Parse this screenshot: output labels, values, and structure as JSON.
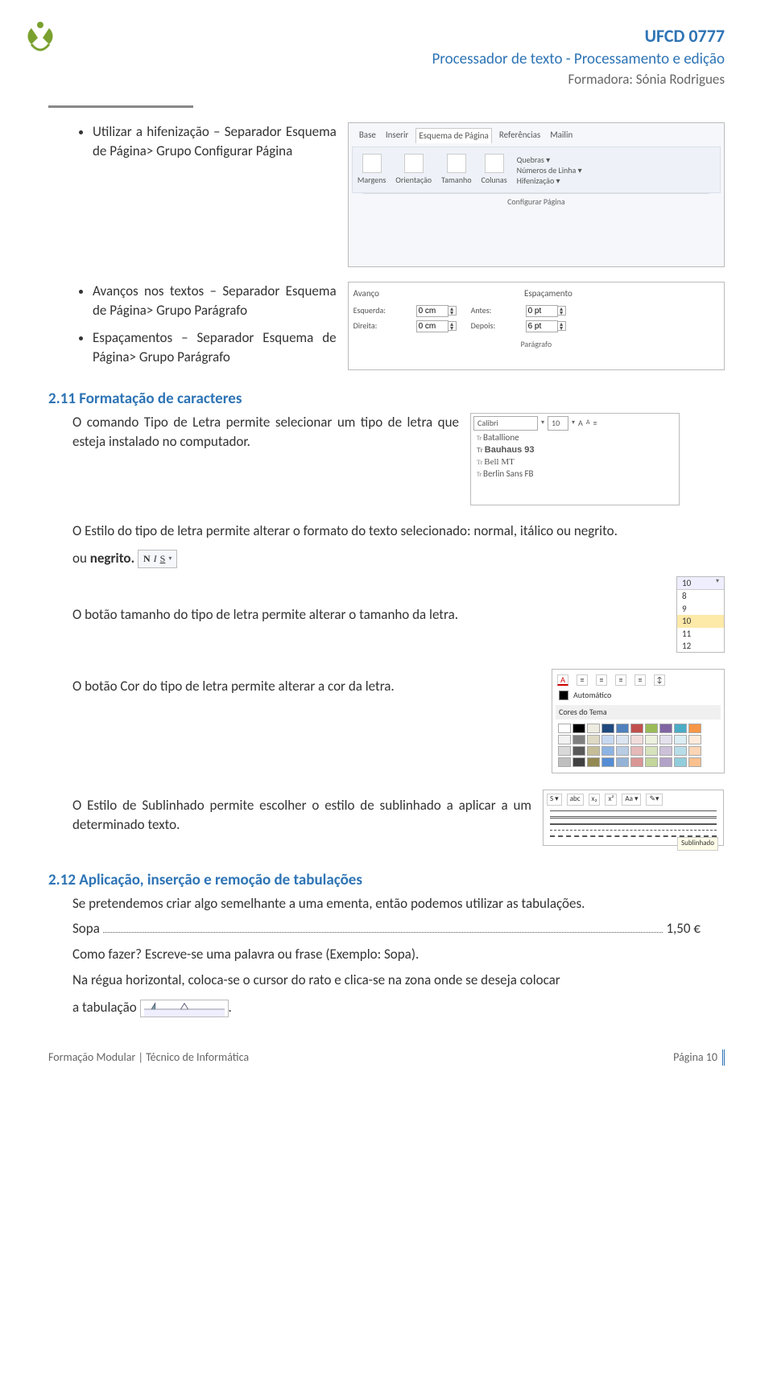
{
  "header": {
    "title": "UFCD 0777",
    "subtitle": "Processador de texto - Processamento e edição",
    "trainer": "Formadora: Sónia Rodrigues"
  },
  "bullets_top": [
    "Utilizar a hifenização – Separador Esquema de Página> Grupo Configurar Página",
    "Avanços nos textos – Separador Esquema de Página> Grupo Parágrafo",
    "Espaçamentos – Separador Esquema de Página> Grupo Parágrafo"
  ],
  "ribbon": {
    "tabs": [
      "Base",
      "Inserir",
      "Esquema de Página",
      "Referências",
      "Mailin"
    ],
    "active_tab": "Esquema de Página",
    "buttons": [
      "Margens",
      "Orientação",
      "Tamanho",
      "Colunas"
    ],
    "side_items": [
      "Quebras ▾",
      "Números de Linha ▾",
      "Hifenização ▾"
    ],
    "group_label": "Configurar Página"
  },
  "para_dialog": {
    "hdr_left": "Avanço",
    "hdr_right": "Espaçamento",
    "rows": [
      {
        "left_label": "Esquerda:",
        "left_val": "0 cm",
        "right_label": "Antes:",
        "right_val": "0 pt"
      },
      {
        "left_label": "Direita:",
        "left_val": "0 cm",
        "right_label": "Depois:",
        "right_val": "6 pt"
      }
    ],
    "group_label": "Parágrafo"
  },
  "sec211": {
    "heading": "2.11 Formatação de caracteres",
    "p1": "O comando Tipo de Letra permite selecionar um tipo de letra que esteja instalado no computador.",
    "font_combo": {
      "font": "Calibri",
      "size": "10",
      "extra": "A  A"
    },
    "font_list": [
      "Batallione",
      "Bauhaus 93",
      "Bell MT",
      "Berlin Sans FB"
    ],
    "p2a": "O Estilo do tipo de letra permite alterar o formato do texto selecionado: normal, itálico ou negrito.",
    "p2_prefix": "ou ",
    "p2_bold": "negrito.",
    "bolditalic": {
      "b": "N",
      "i": "I",
      "u": "S",
      "arrow": "▾"
    },
    "p3": "O botão tamanho do tipo de letra permite alterar o tamanho da letra.",
    "sizelist": {
      "top": "10",
      "items": [
        "8",
        "9",
        "10",
        "11",
        "12"
      ],
      "selected": "10"
    },
    "p4": "O botão Cor do tipo de letra permite alterar a cor da letra.",
    "color": {
      "auto": "Automático",
      "theme_label": "Cores do Tema",
      "row1": [
        "#ffffff",
        "#000000",
        "#eeece1",
        "#1f497d",
        "#4f81bd",
        "#c0504d",
        "#9bbb59",
        "#8064a2",
        "#4bacc6",
        "#f79646"
      ],
      "row2": [
        "#f2f2f2",
        "#7f7f7f",
        "#ddd9c3",
        "#c6d9f0",
        "#dbe5f1",
        "#f2dcdb",
        "#ebf1dd",
        "#e5e0ec",
        "#dbeef3",
        "#fdeada"
      ],
      "row3": [
        "#d9d9d9",
        "#595959",
        "#c4bd97",
        "#8db3e2",
        "#b8cce4",
        "#e5b9b7",
        "#d7e3bc",
        "#ccc1d9",
        "#b7dde8",
        "#fbd5b5"
      ],
      "row4": [
        "#bfbfbf",
        "#404040",
        "#938953",
        "#548dd4",
        "#95b3d7",
        "#d99694",
        "#c3d69b",
        "#b2a2c7",
        "#92cddc",
        "#fac08f"
      ]
    },
    "p5": "O Estilo de Sublinhado permite escolher o estilo de sublinhado a aplicar a um determinado texto.",
    "underline_tooltip": "Sublinhado",
    "ul_tabs": [
      "S ▾",
      "abc",
      "x₂",
      "x²",
      "Aa ▾",
      "✎▾"
    ]
  },
  "sec212": {
    "heading": "2.12 Aplicação, inserção e remoção de tabulações",
    "p1": "Se pretendemos criar algo semelhante a uma ementa, então podemos utilizar as tabulações.",
    "leader_left": "Sopa",
    "leader_right": "1,50 €",
    "p2": "Como fazer? Escreve-se uma palavra ou frase (Exemplo: Sopa).",
    "p3": "Na régua horizontal, coloca-se o cursor do rato e clica-se na zona onde se deseja colocar",
    "p3_suffix_prefix": "a tabulação ",
    "p3_suffix": "."
  },
  "footer": {
    "left": "Formação Modular | Técnico de Informática",
    "right": "Página 10"
  }
}
